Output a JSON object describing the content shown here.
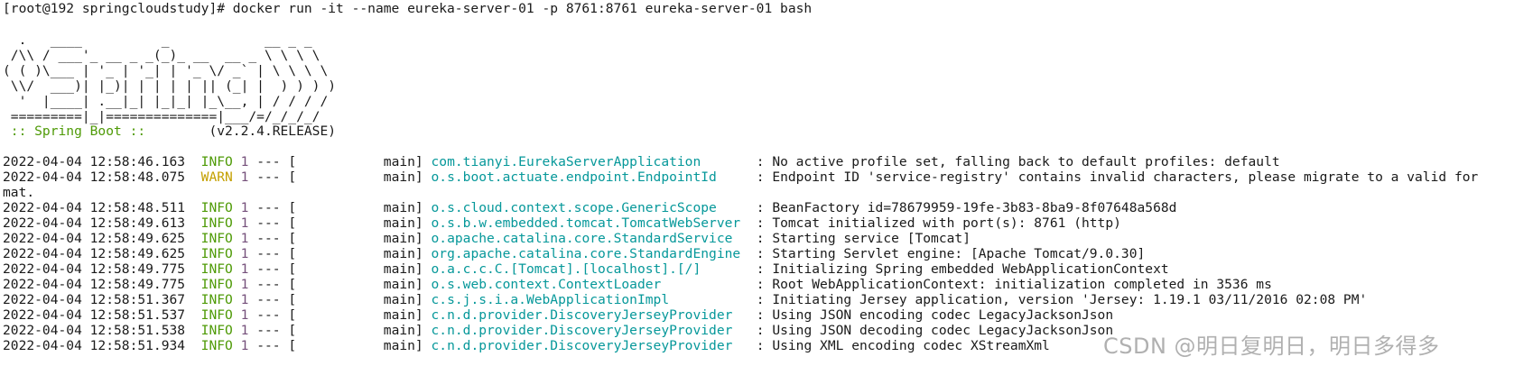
{
  "command": "[root@192 springcloudstudy]# docker run -it --name eureka-server-01 -p 8761:8761 eureka-server-01 bash",
  "banner": [
    "  .   ____          _            __ _ _",
    " /\\\\ / ___'_ __ _ _(_)_ __  __ _ \\ \\ \\ \\",
    "( ( )\\___ | '_ | '_| | '_ \\/ _` | \\ \\ \\ \\",
    " \\\\/  ___)| |_)| | | | | || (_| |  ) ) ) )",
    "  '  |____| .__|_| |_|_| |_\\__, | / / / /",
    " =========|_|==============|___/=/_/_/_/"
  ],
  "spring_boot": {
    "label": " :: Spring Boot :: ",
    "version": "       (v2.2.4.RELEASE)"
  },
  "logs": [
    {
      "ts": "2022-04-04 12:58:46.163",
      "level": "INFO",
      "pid": "1",
      "sep": " --- [",
      "thread": "           main] ",
      "logger": "com.tianyi.EurekaServerApplication      ",
      "message": " : No active profile set, falling back to default profiles: default"
    },
    {
      "ts": "2022-04-04 12:58:48.075",
      "level": "WARN",
      "pid": "1",
      "sep": " --- [",
      "thread": "           main] ",
      "logger": "o.s.boot.actuate.endpoint.EndpointId    ",
      "message": " : Endpoint ID 'service-registry' contains invalid characters, please migrate to a valid for"
    },
    {
      "continuation": "mat."
    },
    {
      "ts": "2022-04-04 12:58:48.511",
      "level": "INFO",
      "pid": "1",
      "sep": " --- [",
      "thread": "           main] ",
      "logger": "o.s.cloud.context.scope.GenericScope    ",
      "message": " : BeanFactory id=78679959-19fe-3b83-8ba9-8f07648a568d"
    },
    {
      "ts": "2022-04-04 12:58:49.613",
      "level": "INFO",
      "pid": "1",
      "sep": " --- [",
      "thread": "           main] ",
      "logger": "o.s.b.w.embedded.tomcat.TomcatWebServer ",
      "message": " : Tomcat initialized with port(s): 8761 (http)"
    },
    {
      "ts": "2022-04-04 12:58:49.625",
      "level": "INFO",
      "pid": "1",
      "sep": " --- [",
      "thread": "           main] ",
      "logger": "o.apache.catalina.core.StandardService  ",
      "message": " : Starting service [Tomcat]"
    },
    {
      "ts": "2022-04-04 12:58:49.625",
      "level": "INFO",
      "pid": "1",
      "sep": " --- [",
      "thread": "           main] ",
      "logger": "org.apache.catalina.core.StandardEngine ",
      "message": " : Starting Servlet engine: [Apache Tomcat/9.0.30]"
    },
    {
      "ts": "2022-04-04 12:58:49.775",
      "level": "INFO",
      "pid": "1",
      "sep": " --- [",
      "thread": "           main] ",
      "logger": "o.a.c.c.C.[Tomcat].[localhost].[/]      ",
      "message": " : Initializing Spring embedded WebApplicationContext"
    },
    {
      "ts": "2022-04-04 12:58:49.775",
      "level": "INFO",
      "pid": "1",
      "sep": " --- [",
      "thread": "           main] ",
      "logger": "o.s.web.context.ContextLoader           ",
      "message": " : Root WebApplicationContext: initialization completed in 3536 ms"
    },
    {
      "ts": "2022-04-04 12:58:51.367",
      "level": "INFO",
      "pid": "1",
      "sep": " --- [",
      "thread": "           main] ",
      "logger": "c.s.j.s.i.a.WebApplicationImpl          ",
      "message": " : Initiating Jersey application, version 'Jersey: 1.19.1 03/11/2016 02:08 PM'"
    },
    {
      "ts": "2022-04-04 12:58:51.537",
      "level": "INFO",
      "pid": "1",
      "sep": " --- [",
      "thread": "           main] ",
      "logger": "c.n.d.provider.DiscoveryJerseyProvider  ",
      "message": " : Using JSON encoding codec LegacyJacksonJson"
    },
    {
      "ts": "2022-04-04 12:58:51.538",
      "level": "INFO",
      "pid": "1",
      "sep": " --- [",
      "thread": "           main] ",
      "logger": "c.n.d.provider.DiscoveryJerseyProvider  ",
      "message": " : Using JSON decoding codec LegacyJacksonJson"
    },
    {
      "ts": "2022-04-04 12:58:51.934",
      "level": "INFO",
      "pid": "1",
      "sep": " --- [",
      "thread": "           main] ",
      "logger": "c.n.d.provider.DiscoveryJerseyProvider  ",
      "message": " : Using XML encoding codec XStreamXml"
    }
  ],
  "watermark": "CSDN @明日复明日，明日多得多",
  "colors": {
    "background": "#ffffff",
    "text": "#1a1a1a",
    "info": "#4e9a06",
    "warn": "#c4a000",
    "pid": "#75507b",
    "logger": "#06989a",
    "spring_boot": "#4e9a06"
  }
}
